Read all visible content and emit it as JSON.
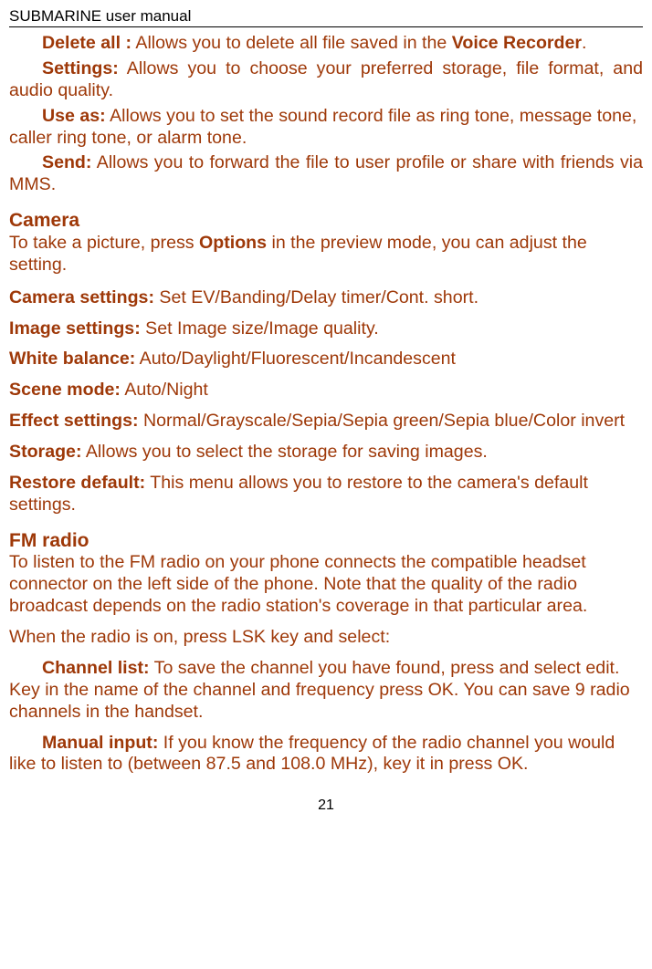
{
  "header": {
    "title": "SUBMARINE user manual"
  },
  "lines": {
    "l1a": "Delete all :",
    "l1b": " Allows you to delete all file saved in the ",
    "l1c": "Voice Recorder",
    "l1d": ".",
    "l2a": "Settings:",
    "l2b": " Allows you to choose your preferred storage, file format, and audio quality.",
    "l3a": "Use as:",
    "l3b": " Allows you to set the sound record file as ring tone, message tone, caller ring tone, or alarm tone.",
    "l4a": "Send:",
    "l4b": " Allows you to forward the file to user profile or share with friends via MMS."
  },
  "camera": {
    "title": "Camera",
    "intro_a": "To take a picture, press ",
    "intro_b": "Options",
    "intro_c": " in the preview mode, you can adjust the setting.",
    "cs_a": "Camera settings:",
    "cs_b": " Set EV/Banding/Delay timer/Cont. short.",
    "is_a": "Image settings:",
    "is_b": " Set Image size/Image quality.",
    "wb_a": "White balance:",
    "wb_b": " Auto/Daylight/Fluorescent/Incandescent",
    "sm_a": "Scene mode:",
    "sm_b": " Auto/Night",
    "es_a": "Effect settings:",
    "es_b": " Normal/Grayscale/Sepia/Sepia green/Sepia blue/Color invert",
    "st_a": "Storage:",
    "st_b": " Allows you to select the storage for saving images.",
    "rd_a": "Restore default:",
    "rd_b": " This menu allows you to restore to the camera's default settings."
  },
  "fm": {
    "title": "FM radio",
    "intro": "To listen to the FM radio on your phone connects the compatible headset connector on the left side of the phone. Note that the quality of the radio broadcast depends on the radio station's coverage in that particular area.",
    "on": "When the radio is on, press LSK key and select:",
    "cl_a": "Channel list:",
    "cl_b": " To save the channel you have found, press and select edit. Key in the name of the channel and frequency press OK. You can save 9 radio channels in the handset.",
    "mi_a": "Manual input:",
    "mi_b": " If you know the frequency of the radio channel you would like to listen to (between 87.5 and 108.0 MHz), key it in press OK."
  },
  "page_number": "21"
}
